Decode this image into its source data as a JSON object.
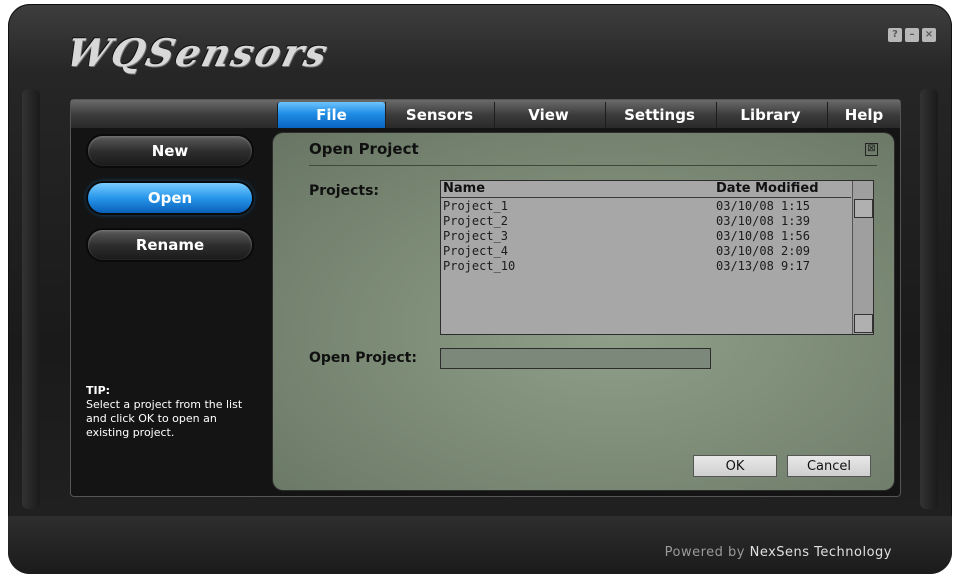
{
  "app": {
    "logo_text": "WQSensors",
    "window_buttons": [
      "?",
      "–",
      "×"
    ]
  },
  "tabs": [
    {
      "label": "File",
      "active": true
    },
    {
      "label": "Sensors",
      "active": false
    },
    {
      "label": "View",
      "active": false
    },
    {
      "label": "Settings",
      "active": false
    },
    {
      "label": "Library",
      "active": false
    },
    {
      "label": "Help",
      "active": false
    }
  ],
  "sidebar": {
    "buttons": [
      {
        "label": "New",
        "active": false
      },
      {
        "label": "Open",
        "active": true
      },
      {
        "label": "Rename",
        "active": false
      }
    ],
    "tip_title": "TIP:",
    "tip_text": "Select a project from the list and click OK to open an existing project."
  },
  "dialog": {
    "title": "Open Project",
    "close_symbol": "⊠",
    "projects_label": "Projects:",
    "columns": {
      "name": "Name",
      "date": "Date Modified"
    },
    "rows": [
      {
        "name": "Project_1",
        "date": "03/10/08 1:15"
      },
      {
        "name": "Project_2",
        "date": "03/10/08 1:39"
      },
      {
        "name": "Project_3",
        "date": "03/10/08 1:56"
      },
      {
        "name": "Project_4",
        "date": "03/10/08 2:09"
      },
      {
        "name": "Project_10",
        "date": "03/13/08 9:17"
      }
    ],
    "open_project_label": "Open Project:",
    "open_project_value": "",
    "ok_label": "OK",
    "cancel_label": "Cancel"
  },
  "footer": {
    "powered_prefix": "Powered by ",
    "brand": "NexSens Technology"
  },
  "colors": {
    "accent_blue": "#1f8de4",
    "panel_green": "#7e8d78",
    "list_gray": "#a7a7a7"
  }
}
